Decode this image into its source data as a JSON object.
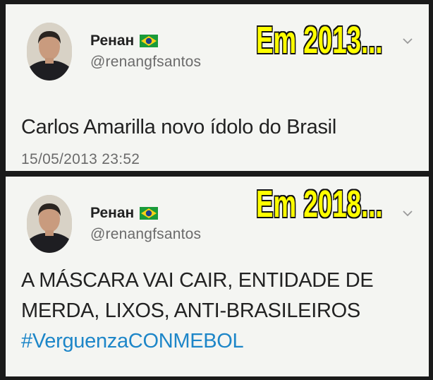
{
  "tweets": [
    {
      "name": "Ренан",
      "handle": "@renangfsantos",
      "overlay": "Em 2013...",
      "text_lines": [
        "Carlos Amarilla novo ídolo do Brasil"
      ],
      "timestamp": "15/05/2013 23:52",
      "flag_icon": "brazil-flag-icon",
      "menu_icon": "chevron-down-icon"
    },
    {
      "name": "Ренан",
      "handle": "@renangfsantos",
      "overlay": "Em 2018...",
      "text_lines": [
        "A MÁSCARA VAI CAIR, ENTIDADE DE",
        "MERDA, LIXOS, ANTI-BRASILEIROS"
      ],
      "hashtag": "#VerguenzaCONMEBOL",
      "flag_icon": "brazil-flag-icon",
      "menu_icon": "chevron-down-icon"
    }
  ],
  "colors": {
    "background": "#1a1a1a",
    "card": "#f4f5f2",
    "overlay_text": "#ffff00",
    "hashtag": "#1d86c8"
  }
}
